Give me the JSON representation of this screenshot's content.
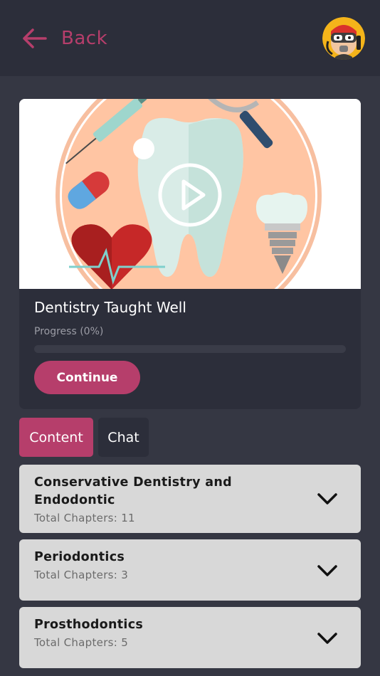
{
  "header": {
    "back_label": "Back",
    "back_icon": "arrow-left-icon",
    "avatar_icon": "diver-mascot-avatar"
  },
  "course": {
    "title": "Dentistry Taught Well",
    "progress_label": "Progress (0%)",
    "progress_percent": 0,
    "continue_label": "Continue",
    "thumbnail_icon": "dentistry-illustration",
    "play_icon": "play-icon"
  },
  "tabs": [
    {
      "label": "Content",
      "active": true
    },
    {
      "label": "Chat",
      "active": false
    }
  ],
  "chapters": [
    {
      "title": "Conservative Dentistry and Endodontic",
      "subtitle": "Total Chapters: 11"
    },
    {
      "title": "Periodontics",
      "subtitle": "Total Chapters: 3"
    },
    {
      "title": "Prosthodontics",
      "subtitle": "Total Chapters: 5"
    }
  ],
  "colors": {
    "accent": "#b63e6b",
    "background": "#353743",
    "header": "#2c2e3a",
    "card": "#d8d8d8"
  }
}
